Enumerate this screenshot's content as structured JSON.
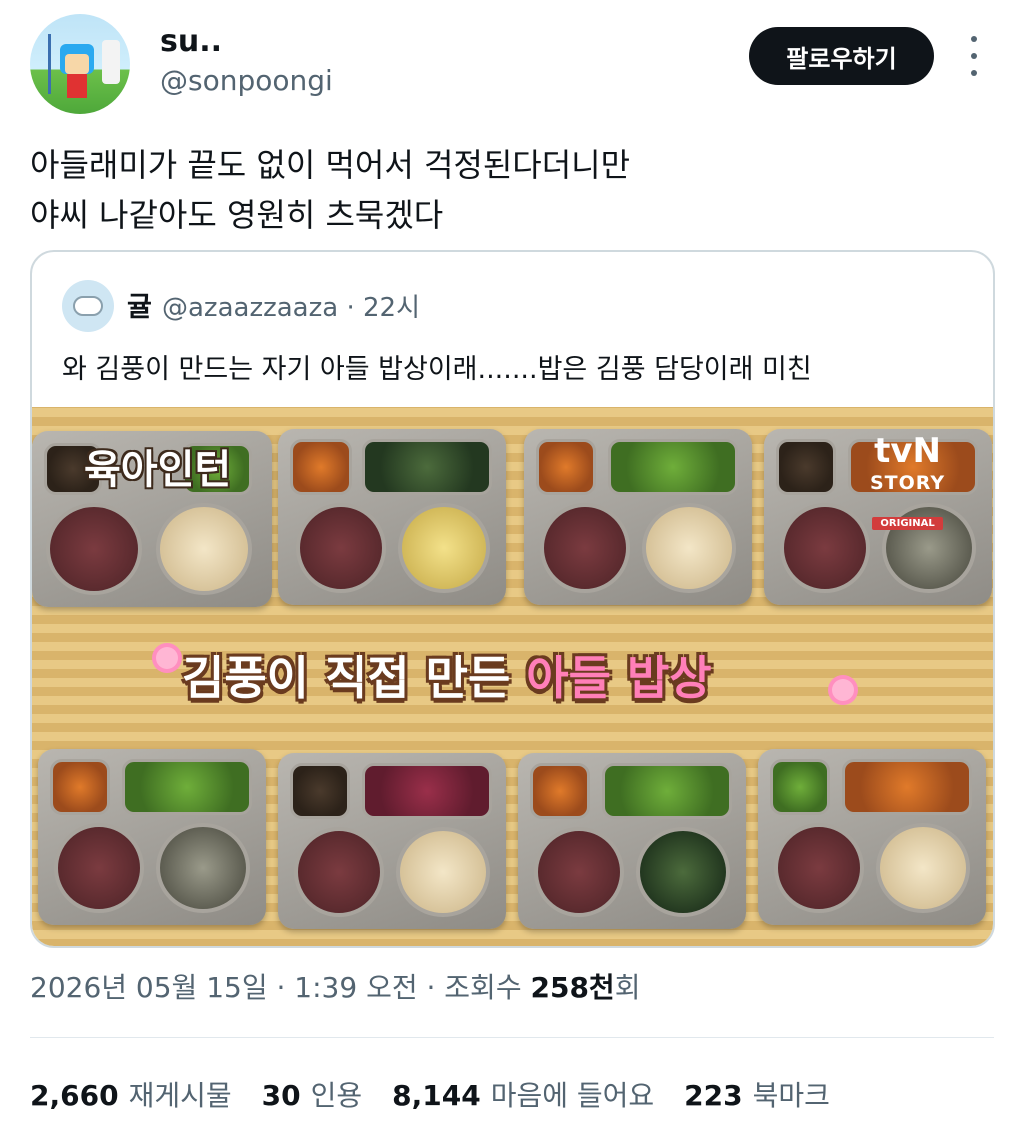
{
  "author": {
    "display_name": "su..",
    "handle": "@sonpoongi",
    "follow_label": "팔로우하기"
  },
  "tweet": {
    "lines": [
      "아들래미가 끝도 없이 먹어서 걱정된다더니만",
      "야씨 나같아도 영원히 츠묵겠다"
    ]
  },
  "quote": {
    "name": "귤",
    "handle_time": "@azaazzaaza · 22시",
    "text": "와 김풍이 만드는 자기 아들 밥상이래.......밥은 김풍 담당이래 미친",
    "media": {
      "caption_main": "김풍이 직접 만든 ",
      "caption_pink": "아들 밥상",
      "logo_left": "육아인턴",
      "logo_right_line1": "tvN",
      "logo_right_line2": "STORY",
      "logo_right_line3": "ORIGINAL"
    }
  },
  "meta": {
    "timestamp": "2026년 05월 15일 · 1:39 오전 · 조회수 ",
    "views": "258천",
    "views_suffix": "회"
  },
  "stats": [
    {
      "count": "2,660",
      "label": "재게시물"
    },
    {
      "count": "30",
      "label": "인용"
    },
    {
      "count": "8,144",
      "label": "마음에 들어요"
    },
    {
      "count": "223",
      "label": "북마크"
    }
  ]
}
